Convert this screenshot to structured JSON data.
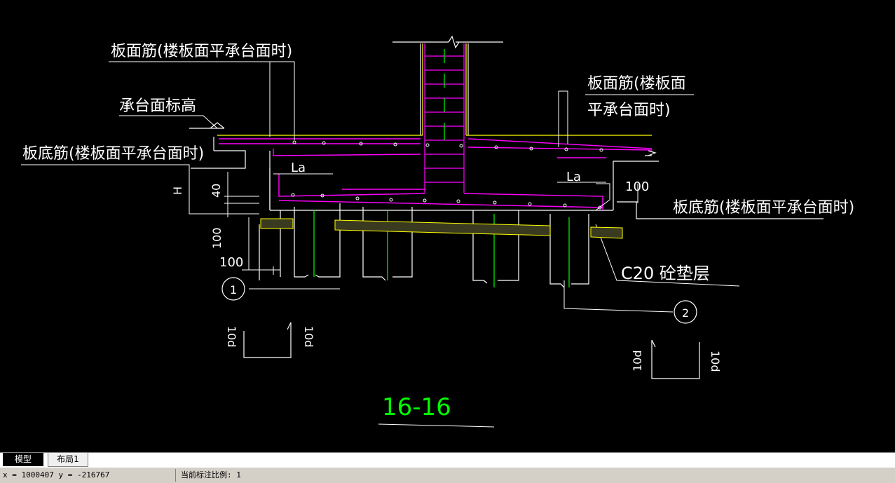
{
  "drawing": {
    "labels": {
      "top_rebar_left": "板面筋(楼板面平承台面时)",
      "cap_elevation": "承台面标高",
      "bottom_rebar_left": "板底筋(楼板面平承台面时)",
      "top_rebar_right_line1": "板面筋(楼板面",
      "top_rebar_right_line2": "平承台面时)",
      "bottom_rebar_right": "板底筋(楼板面平承台面时)",
      "cushion": "C20 砼垫层",
      "la_left": "La",
      "la_right": "La",
      "dim_H": "H",
      "dim_40": "40",
      "dim_100_vertical": "100",
      "dim_100_bottom": "100",
      "dim_100_right": "100",
      "detail_1": "1",
      "detail_2": "2",
      "hook_10d_1": "10d",
      "hook_10d_2": "10d",
      "hook_10d_3": "10d",
      "hook_10d_4": "10d",
      "section_title": "16-16"
    },
    "colors": {
      "background": "#000000",
      "line_white": "#ffffff",
      "rebar_magenta": "#ff00ff",
      "column_yellow": "#ffff00",
      "pile_green": "#00ff00",
      "title_green": "#00ff00"
    }
  },
  "tabs": [
    {
      "label": "模型",
      "active": true
    },
    {
      "label": "布局1",
      "active": false
    }
  ],
  "status": {
    "coordinates": "x = 1000407  y = -216767",
    "scale": "当前标注比例: 1"
  }
}
